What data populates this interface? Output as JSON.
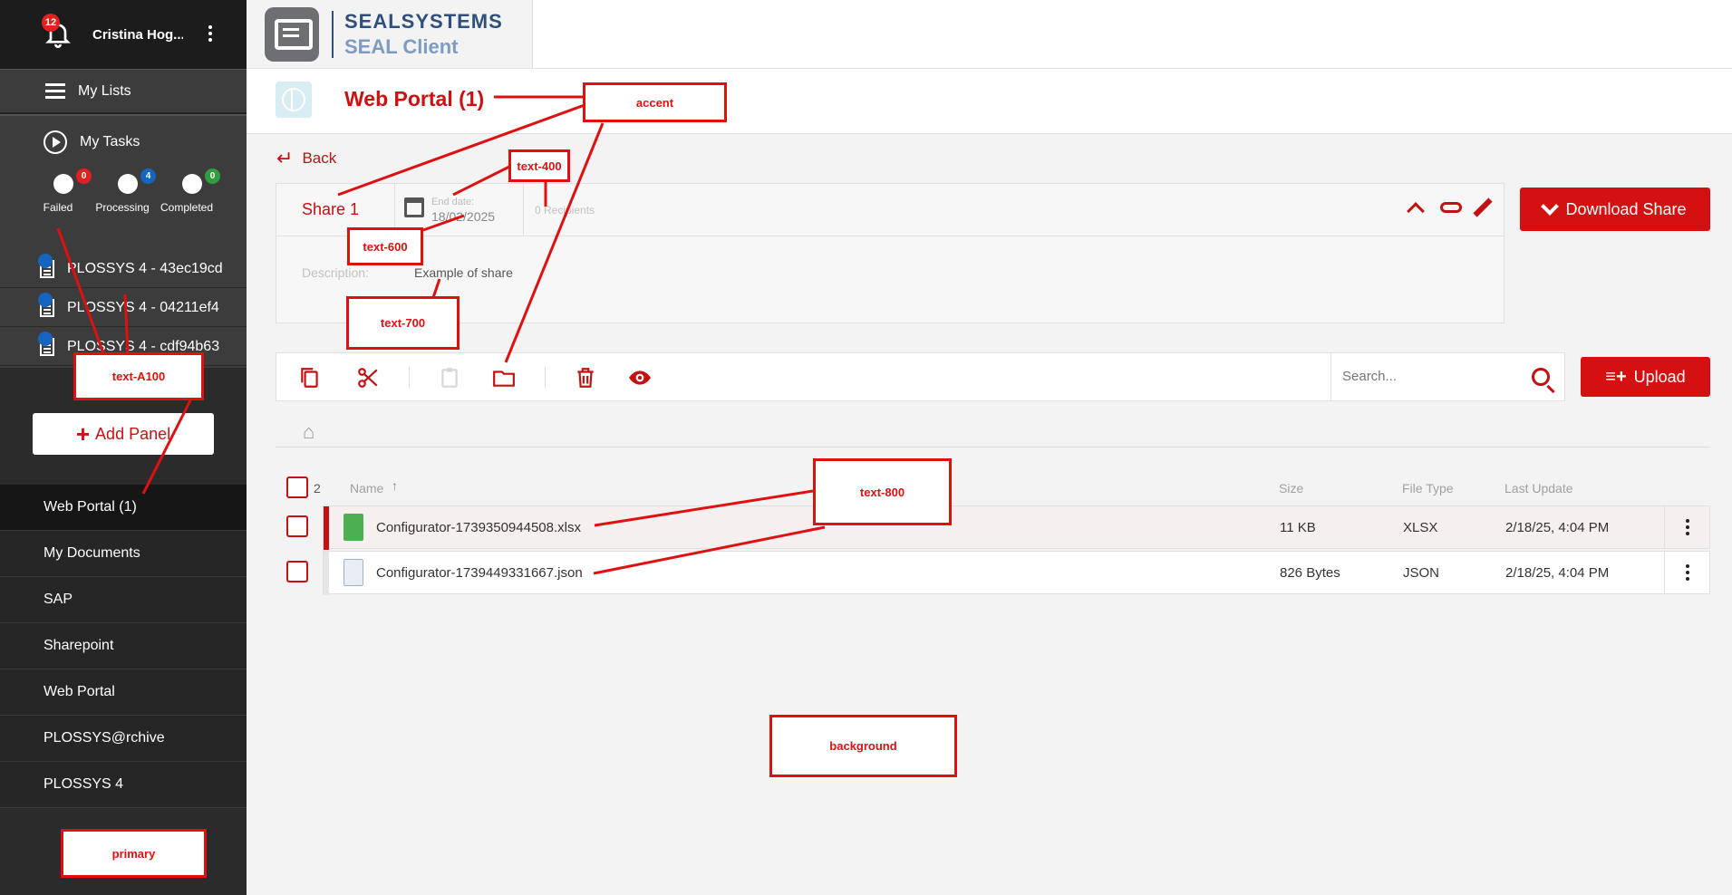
{
  "sidebar": {
    "notifications": "12",
    "username": "Cristina Hog...",
    "my_lists": "My Lists",
    "my_tasks": "My Tasks",
    "task_stats": [
      {
        "label": "Failed",
        "count": "0",
        "color": "#e32020"
      },
      {
        "label": "Processing",
        "count": "4",
        "color": "#1565c0"
      },
      {
        "label": "Completed",
        "count": "0",
        "color": "#2e9e3e"
      }
    ],
    "jobs": [
      "PLOSSYS 4 - 43ec19cd",
      "PLOSSYS 4 - 04211ef4",
      "PLOSSYS 4 - cdf94b63"
    ],
    "add_panel": "Add Panel",
    "nav": [
      "Web Portal (1)",
      "My Documents",
      "SAP",
      "Sharepoint",
      "Web Portal",
      "PLOSSYS@rchive",
      "PLOSSYS 4"
    ]
  },
  "logo": {
    "line1": "SEALSYSTEMS",
    "line2": "SEAL Client"
  },
  "page": {
    "title": "Web Portal (1)",
    "back": "Back"
  },
  "share": {
    "name": "Share 1",
    "end_date_label": "End date:",
    "end_date": "18/02/2025",
    "recipients": "0 Recipients",
    "description_label": "Description:",
    "description": "Example of share",
    "download_label": "Download Share"
  },
  "toolbar": {
    "search_placeholder": "Search...",
    "upload_label": "Upload"
  },
  "table": {
    "selected_count": "2",
    "headers": {
      "name": "Name",
      "size": "Size",
      "type": "File Type",
      "updated": "Last Update"
    },
    "rows": [
      {
        "name": "Configurator-1739350944508.xlsx",
        "size": "11 KB",
        "type": "XLSX",
        "updated": "2/18/25, 4:04 PM",
        "icon": "xlsx-file-icon"
      },
      {
        "name": "Configurator-1739449331667.json",
        "size": "826 Bytes",
        "type": "JSON",
        "updated": "2/18/25, 4:04 PM",
        "icon": "json-file-icon"
      }
    ]
  },
  "annotations": {
    "accent": "accent",
    "text_400": "text-400",
    "text_600": "text-600",
    "text_700": "text-700",
    "text_a100": "text-A100",
    "text_800": "text-800",
    "background": "background",
    "primary": "primary"
  },
  "colors": {
    "accent": "#d41010",
    "primary": "#2b2b2b",
    "background": "#f3f3f3"
  }
}
